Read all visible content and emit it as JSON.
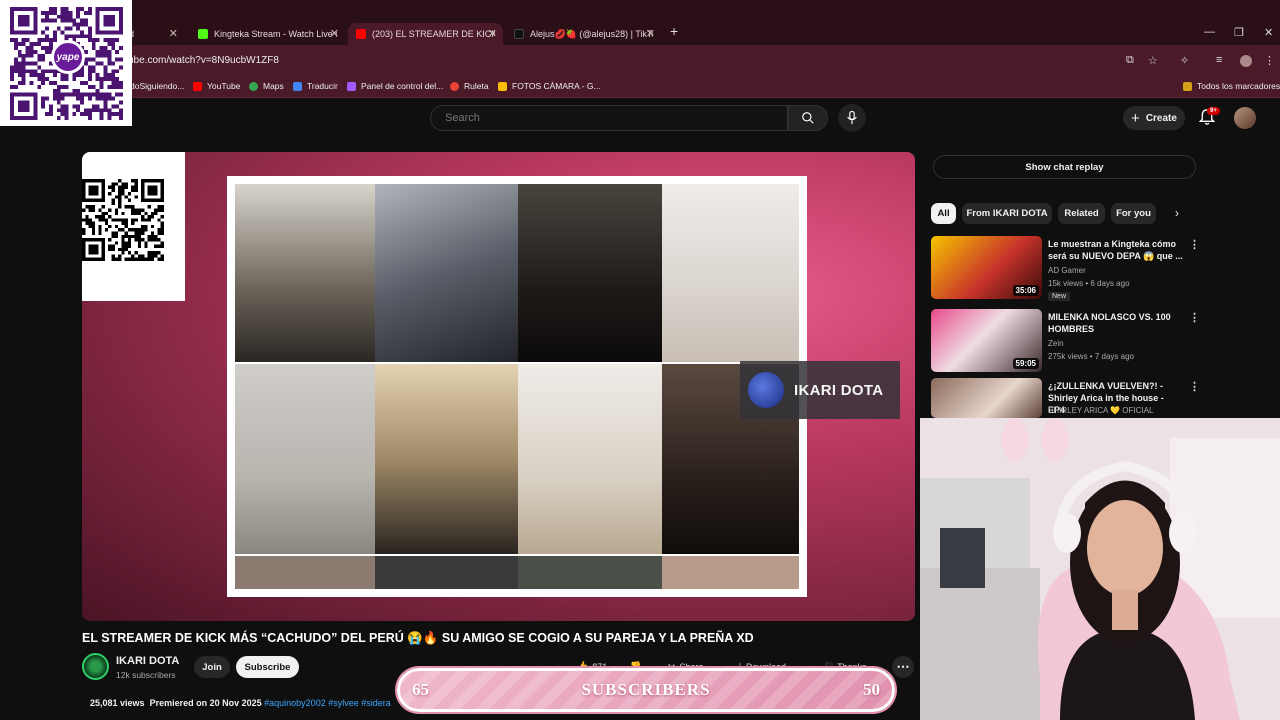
{
  "browser": {
    "tabs": [
      {
        "label": "rd",
        "favicon_color": "#888888"
      },
      {
        "label": "Kingteka Stream - Watch Live o",
        "favicon_color": "#53fc18"
      },
      {
        "label": "(203) EL STREAMER DE KICK M",
        "favicon_color": "#ff0000"
      },
      {
        "label": "Alejus💋🍓 (@alejus28) | TikTo",
        "favicon_color": "#000000"
      }
    ],
    "url": "ube.com/watch?v=8N9ucbW1ZF8",
    "bookmarks": [
      {
        "label": "doSiguiendo...",
        "color": "#9146ff"
      },
      {
        "label": "YouTube",
        "color": "#ff0000"
      },
      {
        "label": "Maps",
        "color": "#34a853"
      },
      {
        "label": "Traducir",
        "color": "#4285f4"
      },
      {
        "label": "Panel de control del...",
        "color": "#a259ff"
      },
      {
        "label": "Ruleta",
        "color": "#ea4335"
      },
      {
        "label": "FOTOS CÁMARA - G...",
        "color": "#fbbc04"
      }
    ],
    "all_bookmarks": "Todos los marcadores"
  },
  "youtube": {
    "search_placeholder": "Search",
    "create_label": "Create",
    "notif_badge": "9+"
  },
  "overlay": {
    "yape_label": "yape",
    "ikari_tag": "IKARI DOTA"
  },
  "video": {
    "title": "EL STREAMER DE KICK MÁS “CACHUDO” DEL PERÚ 😭🔥 SU AMIGO SE COGIO A SU PAREJA Y LA PREÑA XD",
    "channel": "IKARI DOTA",
    "subs": "12k subscribers",
    "join": "Join",
    "subscribe": "Subscribe",
    "likes": "871",
    "share": "Share",
    "download": "Download",
    "thanks": "Thanks",
    "views": "25,081 views",
    "premiered": "Premiered on 20 Nov 2025",
    "tags": "#aquinoby2002 #sylvee #sidera"
  },
  "sidebar": {
    "chat_replay": "Show chat replay",
    "chips": [
      "All",
      "From IKARI DOTA",
      "Related",
      "For you"
    ],
    "recs": [
      {
        "title": "Le muestran a Kingteka cómo será su NUEVO DEPA 😱 que ...",
        "channel": "AD Gamer",
        "meta": "15k views • 6 days ago",
        "badge": "New",
        "duration": "35:06"
      },
      {
        "title": "MILENKA NOLASCO VS. 100 HOMBRES",
        "channel": "Zein",
        "meta": "275k views • 7 days ago",
        "badge": "",
        "duration": "59:05"
      },
      {
        "title": "¿¡ZULLENKA VUELVEN?! - Shirley Arica in the house - EP4",
        "channel": "SHIRLEY ARICA 💛 OFICIAL",
        "meta": "",
        "badge": "",
        "duration": ""
      }
    ]
  },
  "goal": {
    "current": "65",
    "label": "SUBSCRIBERS",
    "target": "50"
  }
}
